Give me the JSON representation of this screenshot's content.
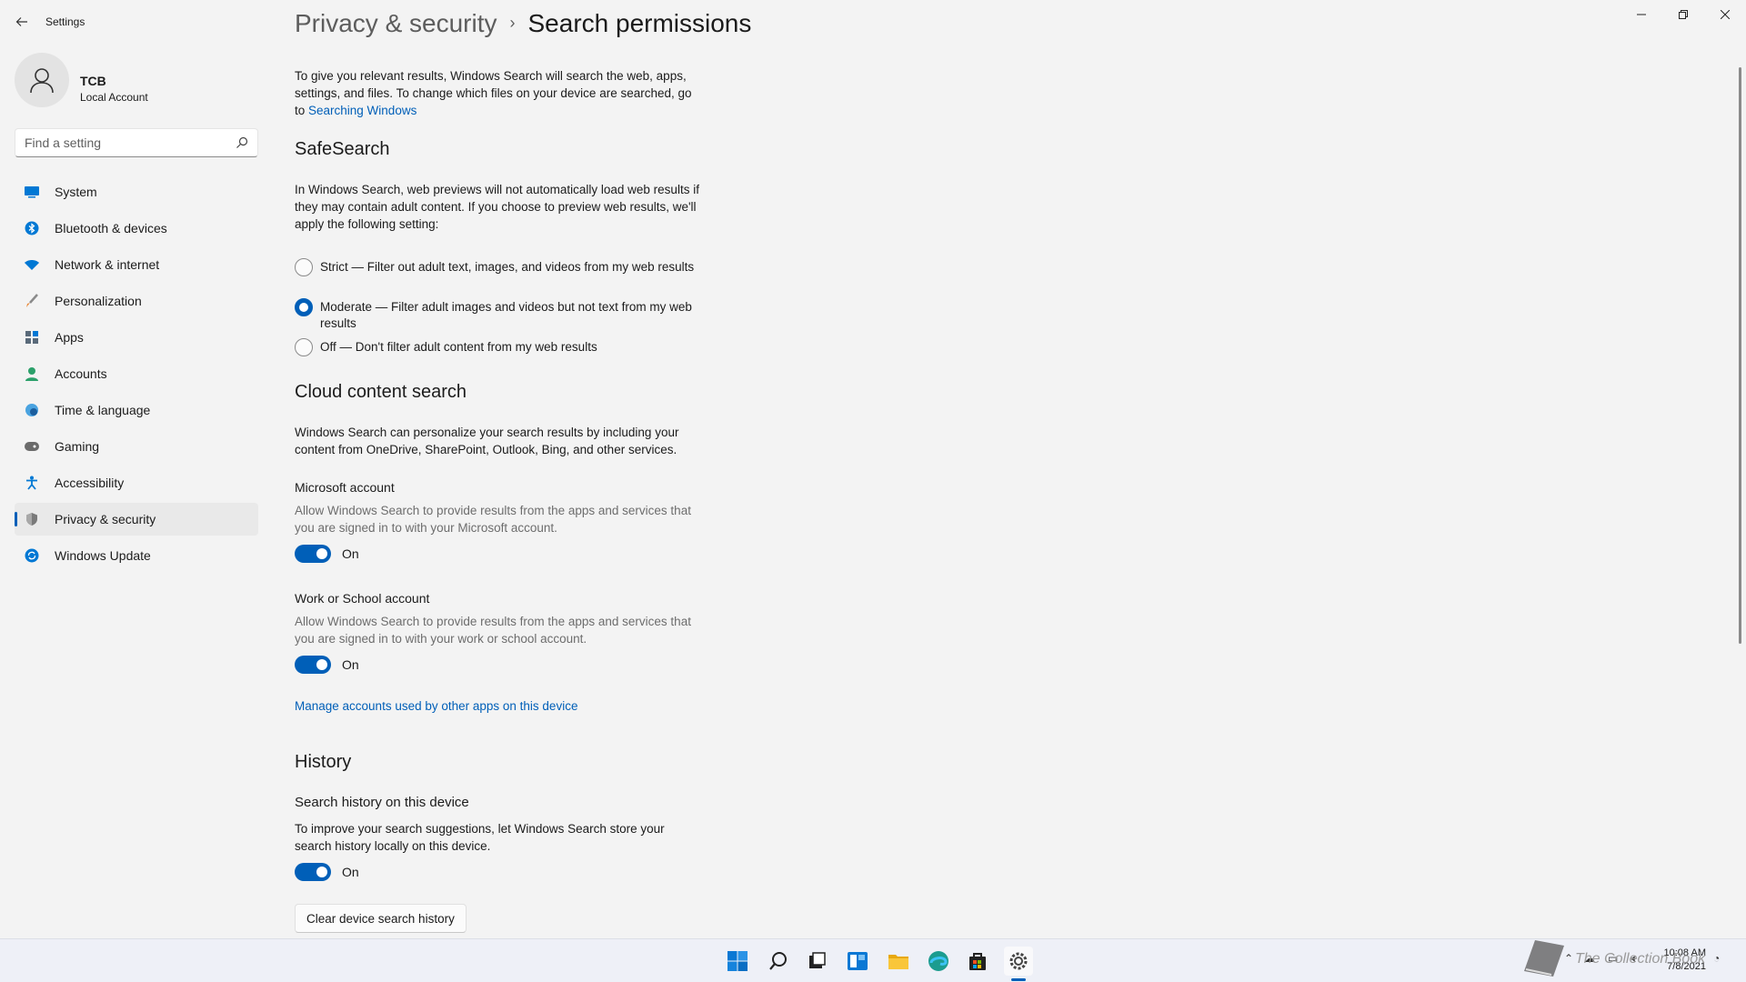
{
  "window": {
    "title": "Settings",
    "controls": {
      "minimize": "–",
      "maximize": "❐",
      "close": "✕"
    }
  },
  "profile": {
    "name": "TCB",
    "account_type": "Local Account"
  },
  "search": {
    "placeholder": "Find a setting"
  },
  "sidebar": {
    "items": [
      {
        "label": "System",
        "icon": "monitor-icon",
        "color": "#0078d4"
      },
      {
        "label": "Bluetooth & devices",
        "icon": "bluetooth-icon",
        "color": "#0078d4"
      },
      {
        "label": "Network & internet",
        "icon": "wifi-icon",
        "color": "#0078d4"
      },
      {
        "label": "Personalization",
        "icon": "brush-icon",
        "color": "#e8883a"
      },
      {
        "label": "Apps",
        "icon": "apps-icon",
        "color": "#5a6a7a"
      },
      {
        "label": "Accounts",
        "icon": "person-icon",
        "color": "#2ba06a"
      },
      {
        "label": "Time & language",
        "icon": "globe-clock-icon",
        "color": "#0078d4"
      },
      {
        "label": "Gaming",
        "icon": "controller-icon",
        "color": "#6b6b6b"
      },
      {
        "label": "Accessibility",
        "icon": "accessibility-icon",
        "color": "#0078d4"
      },
      {
        "label": "Privacy & security",
        "icon": "shield-icon",
        "color": "#6b6b6b",
        "active": true
      },
      {
        "label": "Windows Update",
        "icon": "update-icon",
        "color": "#0078d4"
      }
    ]
  },
  "breadcrumb": {
    "parent": "Privacy & security",
    "separator": "›",
    "current": "Search permissions"
  },
  "intro": {
    "text": "To give you relevant results, Windows Search will search the web, apps, settings, and files. To change which files on your device are searched, go to ",
    "link": "Searching Windows"
  },
  "safesearch": {
    "title": "SafeSearch",
    "description": "In Windows Search, web previews will not automatically load web results if they may contain adult content. If you choose to preview web results, we'll apply the following setting:",
    "options": [
      {
        "label": "Strict — Filter out adult text, images, and videos from my web results",
        "checked": false
      },
      {
        "label": "Moderate — Filter adult images and videos but not text from my web results",
        "checked": true
      },
      {
        "label": "Off — Don't filter adult content from my web results",
        "checked": false
      }
    ]
  },
  "cloud": {
    "title": "Cloud content search",
    "description": "Windows Search can personalize your search results by including your content from OneDrive, SharePoint, Outlook, Bing, and other services.",
    "microsoft": {
      "title": "Microsoft account",
      "description": "Allow Windows Search to provide results from the apps and services that you are signed in to with your Microsoft account.",
      "toggle": "On"
    },
    "work": {
      "title": "Work or School account",
      "description": "Allow Windows Search to provide results from the apps and services that you are signed in to with your work or school account.",
      "toggle": "On"
    },
    "manage_link": "Manage accounts used by other apps on this device"
  },
  "history": {
    "title": "History",
    "subtitle": "Search history on this device",
    "description": "To improve your search suggestions, let Windows Search store your search history locally on this device.",
    "toggle": "On",
    "clear_button": "Clear device search history"
  },
  "taskbar": {
    "icons": [
      "start-icon",
      "search-icon",
      "task-view-icon",
      "widgets-icon",
      "file-explorer-icon",
      "edge-icon",
      "store-icon",
      "settings-icon"
    ],
    "clock": {
      "time": "10:08 AM",
      "date": "7/8/2021"
    },
    "watermark": "The Collection Book"
  },
  "colors": {
    "accent": "#005fb8",
    "background": "#f3f3f3",
    "taskbar": "#eef0f7"
  }
}
